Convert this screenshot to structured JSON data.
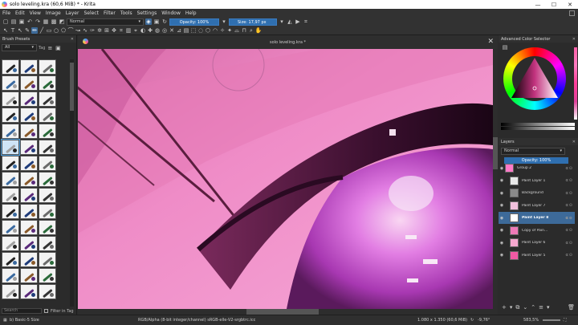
{
  "window": {
    "title": "solo leveling.kra (60,6 MiB) * - Krita",
    "controls": [
      "—",
      "☐",
      "✕"
    ]
  },
  "menu": [
    "File",
    "Edit",
    "View",
    "Image",
    "Layer",
    "Select",
    "Filter",
    "Tools",
    "Settings",
    "Window",
    "Help"
  ],
  "toolbar": {
    "blend_mode": "Normal",
    "opacity": "Opacity: 100%",
    "size": "Size: 17,97 px"
  },
  "left_dock": {
    "title": "Brush Presets",
    "filter": "All",
    "tag_label": "Tag",
    "search_placeholder": "Search",
    "filter_in_tag": "Filter in Tag",
    "brush_count": 45,
    "selected_index": 15
  },
  "document": {
    "tab_title": "solo leveling.kra *"
  },
  "right_dock": {
    "color_title": "Advanced Color Selector",
    "layers_title": "Layers",
    "blend": "Normal",
    "opacity": "Opacity: 100%",
    "layers": [
      {
        "name": "Group 2",
        "thumb": "#ff7ac8",
        "selected": false,
        "indent": 0
      },
      {
        "name": "Paint Layer 1",
        "thumb": "#e8e8e8",
        "selected": false,
        "indent": 1
      },
      {
        "name": "Background",
        "thumb": "#8a8a8a",
        "selected": false,
        "indent": 1
      },
      {
        "name": "Paint Layer 7",
        "thumb": "#f0c0dc",
        "selected": false,
        "indent": 1
      },
      {
        "name": "Paint Layer 8",
        "thumb": "#ffffff",
        "selected": true,
        "indent": 1
      },
      {
        "name": "Copy of Pain...",
        "thumb": "#ee7ab8",
        "selected": false,
        "indent": 1
      },
      {
        "name": "Paint Layer 6",
        "thumb": "#f6a8cf",
        "selected": false,
        "indent": 1
      },
      {
        "name": "Paint Layer 5",
        "thumb": "#f05aa4",
        "selected": false,
        "indent": 1
      }
    ]
  },
  "status": {
    "brush": "b) Basic-5 Size",
    "color_space": "RGB/Alpha (8-bit integer/channel)  sRGB-elle-V2-srgbtrc.icc",
    "dimensions": "1.080 x 1.350 (60,6 MiB)",
    "rotation": "-9,76°",
    "zoom": "583,5%"
  },
  "colors": {
    "accent": "#3d6a99",
    "canvas_pink": "#e874bb",
    "eye_purple": "#b03ab8"
  }
}
